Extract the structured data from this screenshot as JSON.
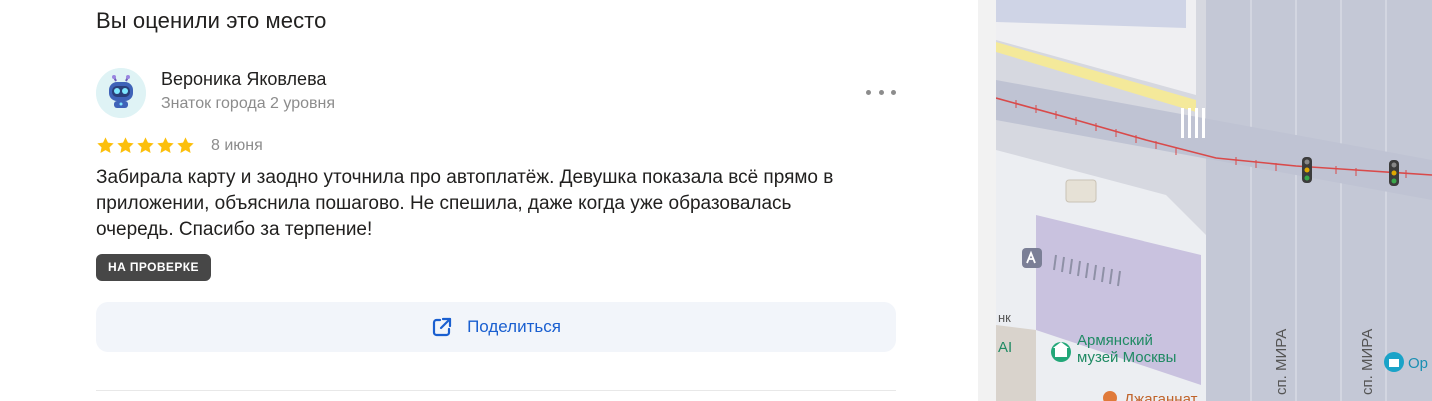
{
  "heading": "Вы оценили это место",
  "review": {
    "author": "Вероника Яковлева",
    "author_level": "Знаток города 2 уровня",
    "rating": 5,
    "date": "8 июня",
    "text": "Забирала карту и заодно уточнила про автоплатёж. Девушка показала всё прямо в\nприложении, объяснила пошагово. Не спешила, даже когда уже образовалась\nочередь. Спасибо за терпение!",
    "status_badge": "НА ПРОВЕРКЕ"
  },
  "actions": {
    "share_label": "Поделиться"
  },
  "icons": {
    "more": "more-dots-icon",
    "share": "share-external-icon",
    "star": "star-icon",
    "avatar": "robot-avatar-icon",
    "museum": "museum-icon",
    "gift": "gift-shop-icon",
    "metro": "metro-icon"
  },
  "colors": {
    "star": "#fcbf0b",
    "link": "#1a5fd0",
    "badge_bg": "#474747",
    "share_bg": "#f2f5fa",
    "museum_pin": "#22a778",
    "rail": "#d94a4a"
  },
  "map": {
    "poi_museum_line1": "Армянский",
    "poi_museum_line2": "музей Москвы",
    "poi_partial_right": "Ор",
    "street_1": "сп. МИРА",
    "street_2": "сп. МИРА",
    "label_left_fragment": "нк",
    "label_left_fragment2": "AI",
    "poi_bottom": "Джаганнат"
  }
}
